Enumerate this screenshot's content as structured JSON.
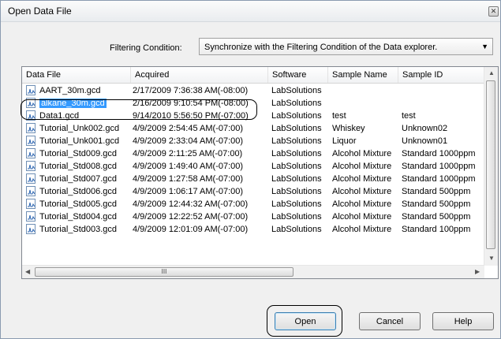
{
  "window": {
    "title": "Open Data File"
  },
  "filter": {
    "label": "Filtering Condition:",
    "value": "Synchronize with the Filtering Condition of the Data explorer."
  },
  "columns": [
    "Data File",
    "Acquired",
    "Software",
    "Sample Name",
    "Sample ID"
  ],
  "rows": [
    {
      "file": "AART_30m.gcd",
      "acquired": "2/17/2009 7:36:38 AM(-08:00)",
      "software": "LabSolutions",
      "sample_name": "",
      "sample_id": ""
    },
    {
      "file": "alkane_30m.gcd",
      "acquired": "2/16/2009 9:10:54 PM(-08:00)",
      "software": "LabSolutions",
      "sample_name": "",
      "sample_id": ""
    },
    {
      "file": "Data1.gcd",
      "acquired": "9/14/2010 5:56:50 PM(-07:00)",
      "software": "LabSolutions",
      "sample_name": "test",
      "sample_id": "test"
    },
    {
      "file": "Tutorial_Unk002.gcd",
      "acquired": "4/9/2009 2:54:45 AM(-07:00)",
      "software": "LabSolutions",
      "sample_name": "Whiskey",
      "sample_id": "Unknown02"
    },
    {
      "file": "Tutorial_Unk001.gcd",
      "acquired": "4/9/2009 2:33:04 AM(-07:00)",
      "software": "LabSolutions",
      "sample_name": "Liquor",
      "sample_id": "Unknown01"
    },
    {
      "file": "Tutorial_Std009.gcd",
      "acquired": "4/9/2009 2:11:25 AM(-07:00)",
      "software": "LabSolutions",
      "sample_name": "Alcohol Mixture",
      "sample_id": "Standard 1000ppm"
    },
    {
      "file": "Tutorial_Std008.gcd",
      "acquired": "4/9/2009 1:49:40 AM(-07:00)",
      "software": "LabSolutions",
      "sample_name": "Alcohol Mixture",
      "sample_id": "Standard 1000ppm"
    },
    {
      "file": "Tutorial_Std007.gcd",
      "acquired": "4/9/2009 1:27:58 AM(-07:00)",
      "software": "LabSolutions",
      "sample_name": "Alcohol Mixture",
      "sample_id": "Standard 1000ppm"
    },
    {
      "file": "Tutorial_Std006.gcd",
      "acquired": "4/9/2009 1:06:17 AM(-07:00)",
      "software": "LabSolutions",
      "sample_name": "Alcohol Mixture",
      "sample_id": "Standard  500ppm"
    },
    {
      "file": "Tutorial_Std005.gcd",
      "acquired": "4/9/2009 12:44:32 AM(-07:00)",
      "software": "LabSolutions",
      "sample_name": "Alcohol Mixture",
      "sample_id": "Standard  500ppm"
    },
    {
      "file": "Tutorial_Std004.gcd",
      "acquired": "4/9/2009 12:22:52 AM(-07:00)",
      "software": "LabSolutions",
      "sample_name": "Alcohol Mixture",
      "sample_id": "Standard  500ppm"
    },
    {
      "file": "Tutorial_Std003.gcd",
      "acquired": "4/9/2009 12:01:09 AM(-07:00)",
      "software": "LabSolutions",
      "sample_name": "Alcohol Mixture",
      "sample_id": "Standard  100ppm"
    }
  ],
  "selected_row": 1,
  "buttons": {
    "open": "Open",
    "cancel": "Cancel",
    "help": "Help"
  },
  "hscroll_grip": "III",
  "icons": {
    "close": "close-icon",
    "dropdown": "chevron-down-icon",
    "file": "chromatogram-file-icon"
  },
  "colors": {
    "selection": "#3399ff",
    "file_icon": "#6f8fb5"
  }
}
